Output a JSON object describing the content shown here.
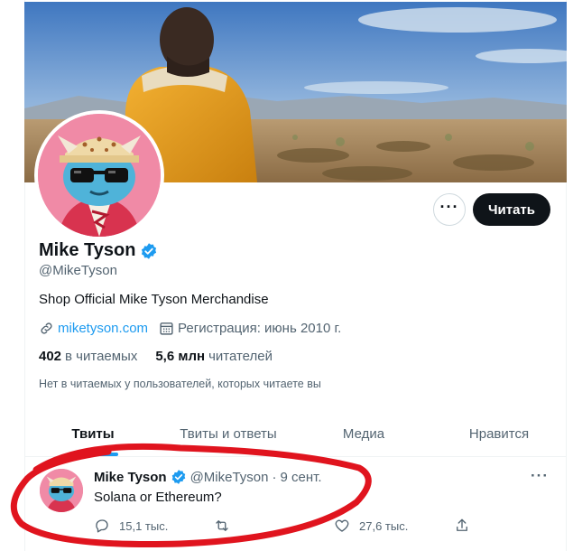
{
  "profile": {
    "name": "Mike Tyson",
    "handle": "@MikeTyson",
    "bio": "Shop Official Mike Tyson Merchandise",
    "website": "miketyson.com",
    "joined": "Регистрация: июнь 2010 г.",
    "following_count": "402",
    "following_label": "в читаемых",
    "followers_count": "5,6 млн",
    "followers_label": "читателей",
    "followed_by_note": "Нет в читаемых у пользователей, которых читаете вы",
    "verified": true
  },
  "buttons": {
    "more_label": "···",
    "follow_label": "Читать"
  },
  "tabs": [
    {
      "label": "Твиты",
      "active": true
    },
    {
      "label": "Твиты и ответы",
      "active": false
    },
    {
      "label": "Медиа",
      "active": false
    },
    {
      "label": "Нравится",
      "active": false
    }
  ],
  "tweet": {
    "author": "Mike Tyson",
    "handle": "@MikeTyson",
    "separator": "·",
    "date": "9 сент.",
    "text": "Solana or Ethereum?",
    "more_label": "···",
    "replies": "15,1 тыс.",
    "retweets": "",
    "likes": "27,6 тыс."
  },
  "colors": {
    "accent": "#1d9bf0",
    "text": "#0f1419",
    "secondary": "#536471",
    "annotation": "#e0141e"
  },
  "icons": {
    "verified": "verified-badge-icon",
    "link": "link-icon",
    "calendar": "calendar-icon",
    "reply": "reply-icon",
    "retweet": "retweet-icon",
    "like": "heart-icon",
    "share": "share-icon"
  }
}
